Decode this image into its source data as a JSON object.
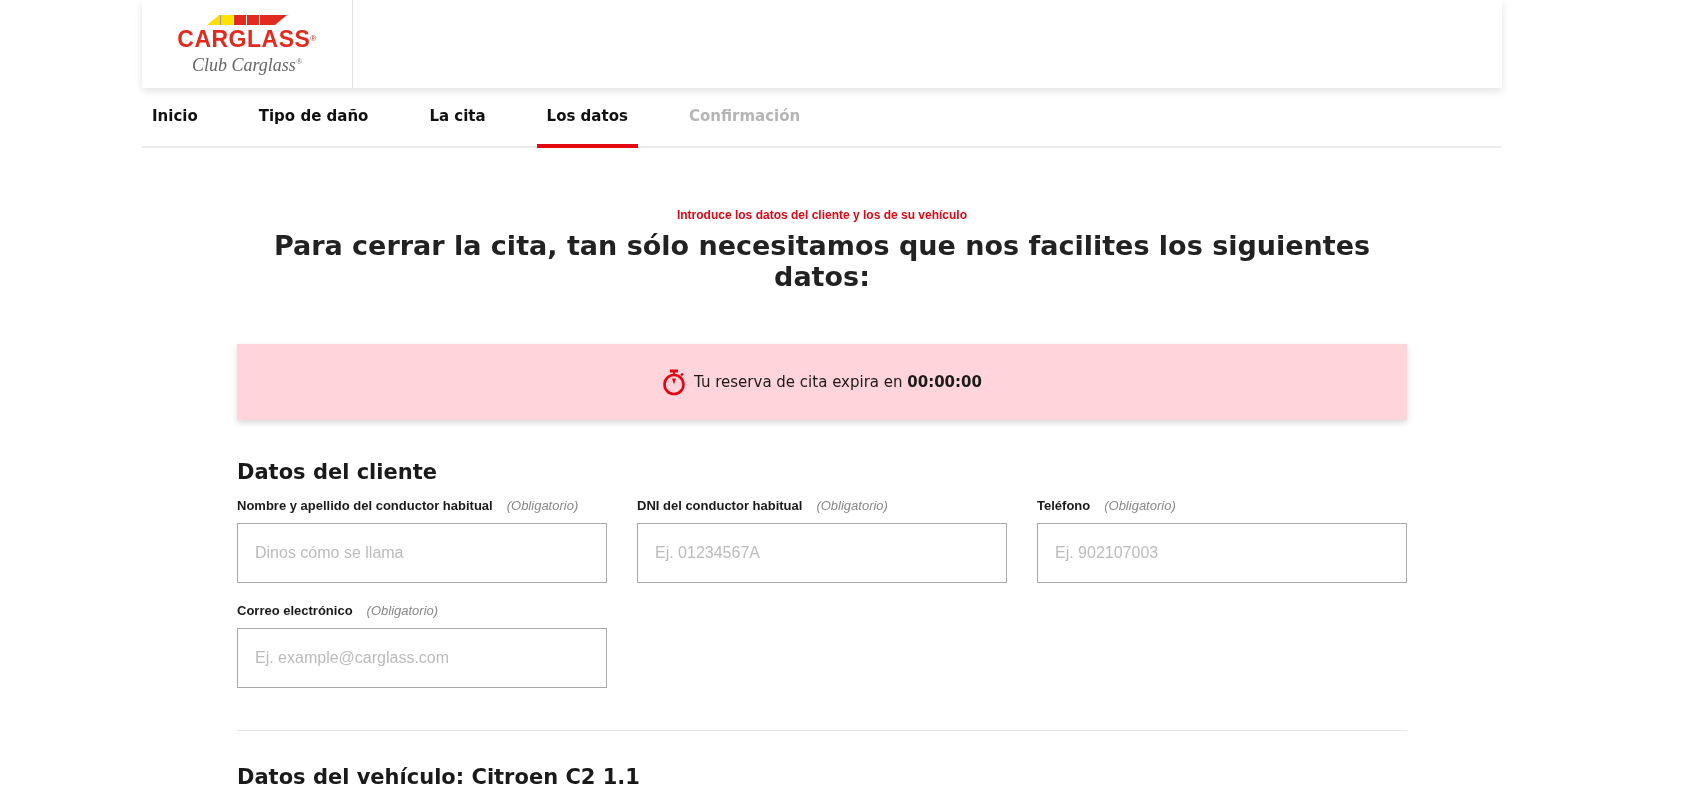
{
  "header": {
    "logo_text": "CARGLASS",
    "logo_mark": "®",
    "club_text": "Club Carglass",
    "club_mark": "®"
  },
  "tabs": [
    {
      "label": "Inicio",
      "selected": false,
      "disabled": false
    },
    {
      "label": "Tipo de daño",
      "selected": false,
      "disabled": false
    },
    {
      "label": "La cita",
      "selected": false,
      "disabled": false
    },
    {
      "label": "Los datos",
      "selected": true,
      "disabled": false
    },
    {
      "label": "Confirmación",
      "selected": false,
      "disabled": true
    }
  ],
  "subtitle": "Introduce los datos del cliente y los de su vehículo",
  "heading": "Para cerrar la cita, tan sólo necesitamos que nos facilites los siguientes datos:",
  "timer_banner": {
    "text": "Tu reserva de cita expira en",
    "time": "00:00:00"
  },
  "client_section": {
    "title": "Datos del cliente",
    "fields": [
      {
        "label": "Nombre y apellido del conductor habitual",
        "hint": "(Obligatorio)",
        "placeholder": "Dinos cómo se llama"
      },
      {
        "label": "DNI del conductor habitual",
        "hint": "(Obligatorio)",
        "placeholder": "Ej. 01234567A"
      },
      {
        "label": "Teléfono",
        "hint": "(Obligatorio)",
        "placeholder": "Ej. 902107003"
      },
      {
        "label": "Correo electrónico",
        "hint": "(Obligatorio)",
        "placeholder": "Ej. example@carglass.com"
      }
    ]
  },
  "vehicle_section": {
    "title": "Datos del vehículo: Citroen C2 1.1"
  }
}
